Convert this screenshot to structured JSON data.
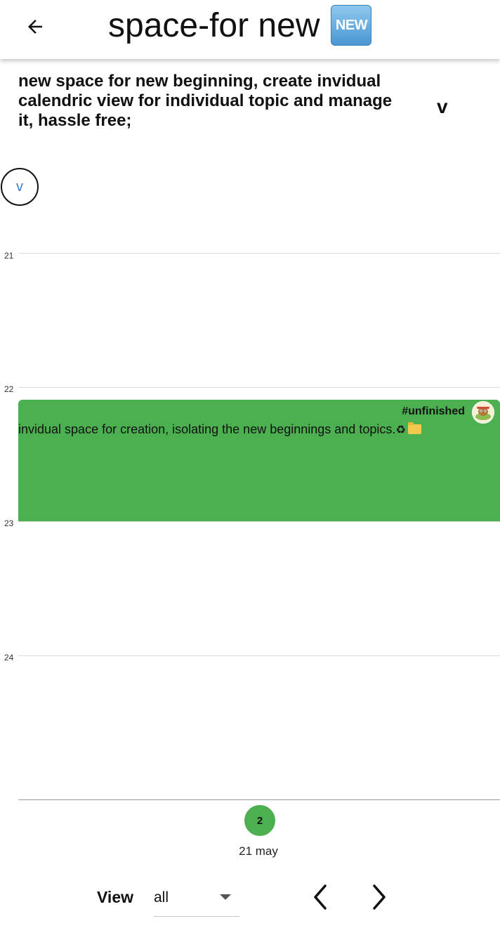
{
  "header": {
    "title": "space-for new",
    "badge": "NEW",
    "back_icon": "arrow-left-icon"
  },
  "space": {
    "description": "new space for new beginning, create invidual calendric view for individual topic and manage it, hassle free;",
    "toggle_label": "v",
    "circle_button_label": "v"
  },
  "timeline": {
    "hours": [
      "21",
      "22",
      "23",
      "24"
    ]
  },
  "event": {
    "tag": "#unfinished",
    "text": "invidual space for creation, isolating the new beginnings and topics.",
    "icons": [
      "recycle-icon",
      "folder-icon"
    ],
    "color": "#4caf50",
    "avatar_icon": "avatar-icon"
  },
  "day": {
    "count": "2",
    "date": "21 may",
    "color": "#4caf50"
  },
  "controls": {
    "view_label": "View",
    "view_value": "all",
    "prev_icon": "chevron-left-icon",
    "next_icon": "chevron-right-icon"
  }
}
